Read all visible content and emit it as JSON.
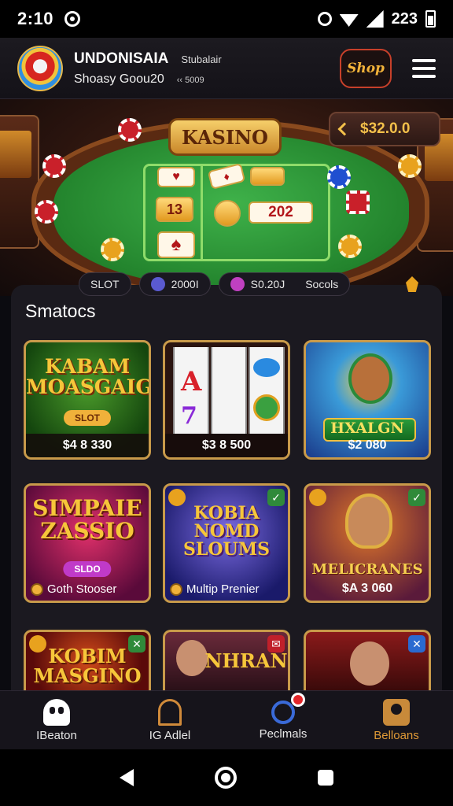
{
  "status_bar": {
    "time": "2:10",
    "right_text": "223"
  },
  "header": {
    "app_name": "UNDONISAIA",
    "app_sub": "Stubalair",
    "app_tagline": "Shoasy Goou20",
    "app_small": "‹‹ 5009",
    "shop_label": "Shop"
  },
  "hero": {
    "table_sign": "KASINO",
    "balance": "$32.0.0",
    "card_values": [
      "13",
      "202"
    ]
  },
  "stats": {
    "slot_label": "SLOT",
    "credit_value": "2000I",
    "coins_value": "S0.20J",
    "social_label": "Socols"
  },
  "section": {
    "title": "Smatocs"
  },
  "games": [
    {
      "title": "KABAM MOASGAIG",
      "badge": "SLOT",
      "value": "$4 8 330"
    },
    {
      "title": "",
      "badge": "",
      "value": "$3 8 500"
    },
    {
      "title": "HXALGN",
      "badge": "",
      "value": "$2 080"
    },
    {
      "title": "SIMPAIE ZASSIO",
      "badge": "SLDO",
      "value": "",
      "label": "Goth Stooser"
    },
    {
      "title": "KOBIA NOMD SLOUMS",
      "badge": "",
      "value": "",
      "label": "Multip Prenier"
    },
    {
      "title": "MELICRANES",
      "badge": "",
      "value": "$A 3 060"
    },
    {
      "title": "KOBIM MASGINO",
      "badge": "",
      "value": ""
    },
    {
      "title": "NHRAN",
      "badge": "",
      "value": ""
    },
    {
      "title": "",
      "badge": "",
      "value": ""
    }
  ],
  "bottom_nav": [
    {
      "label": "IBeaton",
      "icon": "ghost-icon"
    },
    {
      "label": "IG Adlel",
      "icon": "arch-icon"
    },
    {
      "label": "Peclmals",
      "icon": "person-icon"
    },
    {
      "label": "Belloans",
      "icon": "profile-icon"
    }
  ],
  "colors": {
    "accent_gold": "#e09a36",
    "felt_green": "#23842d",
    "card_border": "#c89a4a",
    "background": "#1b1920"
  }
}
